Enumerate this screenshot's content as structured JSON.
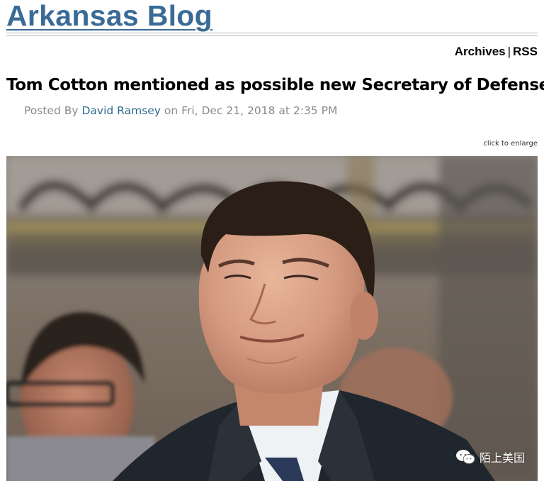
{
  "blog": {
    "title": "Arkansas Blog"
  },
  "nav": {
    "archives": "Archives",
    "separator": "|",
    "rss": "RSS"
  },
  "post": {
    "title": "Tom Cotton mentioned as possible new Secretary of Defense",
    "byline_prefix": "Posted By",
    "author": "David Ramsey",
    "byline_on": "on",
    "date": "Fri, Dec 21, 2018 at 2:35 PM"
  },
  "image": {
    "enlarge_label": "click to enlarge"
  },
  "watermark": {
    "text": "陌上美国",
    "icon": "wechat-icon"
  },
  "colors": {
    "title": "#3a6b96",
    "author_link": "#2e6c8f",
    "byline": "#8a8a8a"
  }
}
